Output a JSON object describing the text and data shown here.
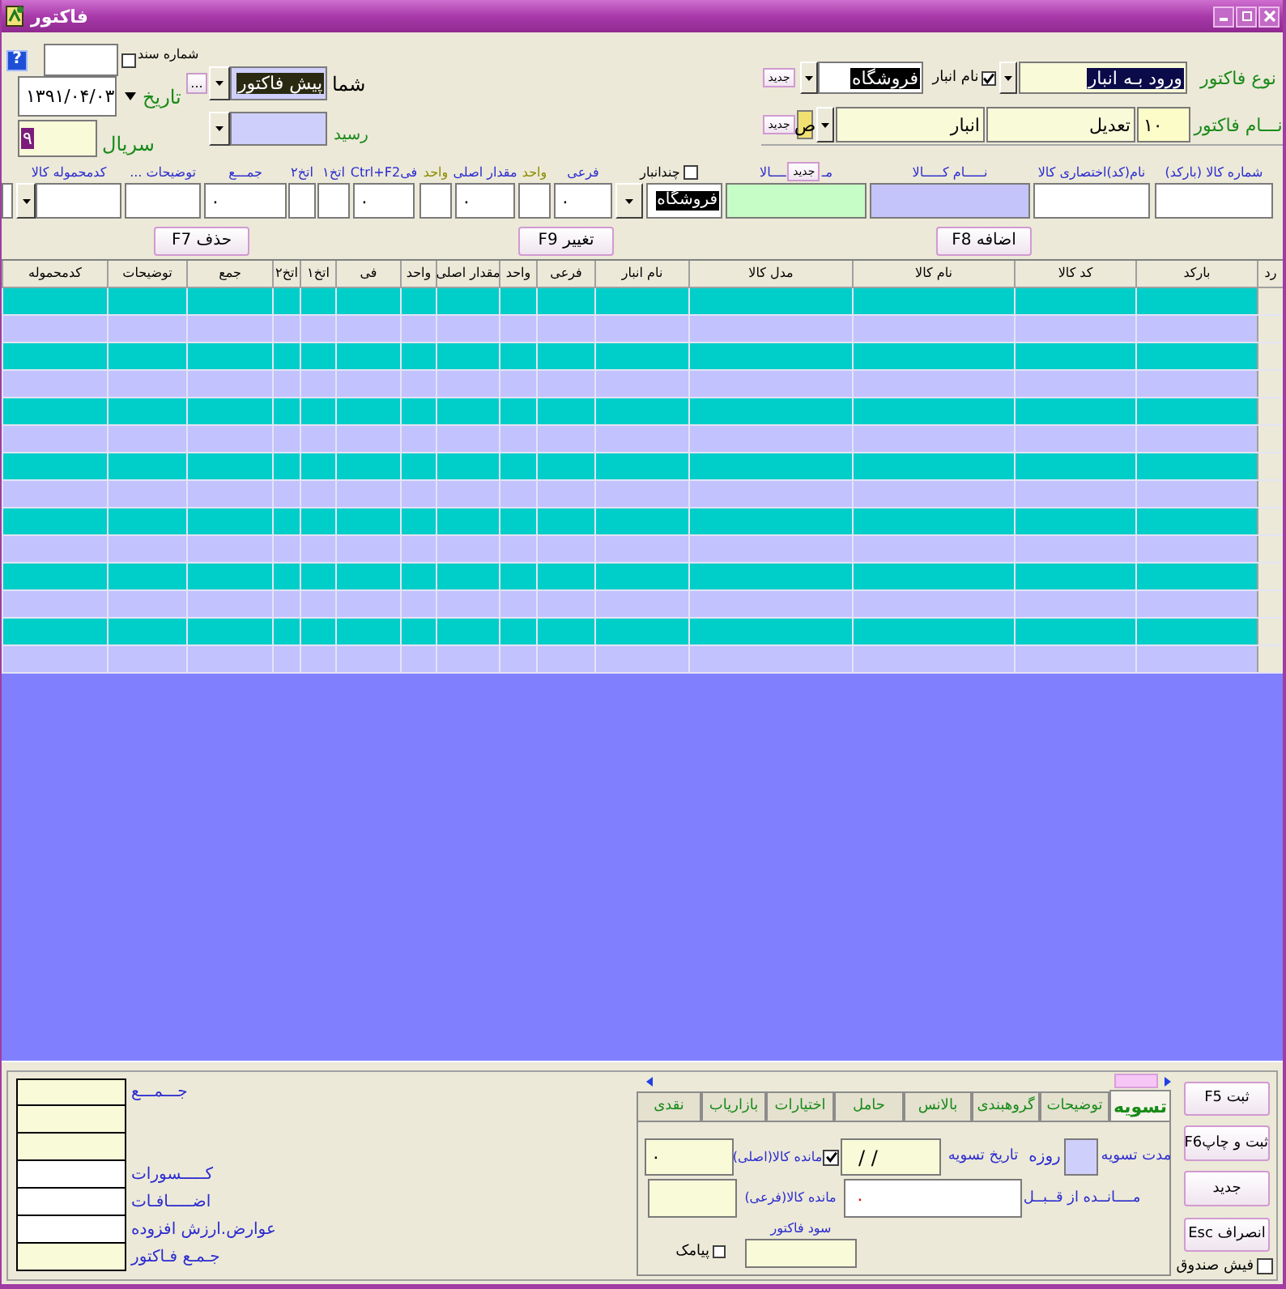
{
  "window": {
    "title": "فاکتور"
  },
  "header": {
    "document_number": {
      "label": "شماره سند",
      "checked": false
    },
    "help_button": "?",
    "date": {
      "label": "تاریخ",
      "value": "۱۳۹۱/۰۴/۰۳"
    },
    "serial": {
      "label": "سریال",
      "value": "۹",
      "highlighted": true
    },
    "party": {
      "label": "شما",
      "value": "پیش فاکتور",
      "highlighted": true,
      "more_button": "..."
    },
    "receipt": {
      "label": "رسید"
    },
    "invoice_type": {
      "label": "نوع فاکتور",
      "value": "ورود بـه انبار",
      "highlighted": true
    },
    "warehouse": {
      "label": "نام انبار",
      "checked": true,
      "value": "فروشگاه",
      "highlighted": true,
      "new_button": "جدید"
    },
    "invoice_name": {
      "label": "نـــام فاکتور",
      "code": "۱۰",
      "name": "تعدیل",
      "group": "انبار",
      "partial_field": "ص",
      "new_button": "جدید"
    }
  },
  "entry": {
    "columns": [
      {
        "label": "شماره کالا (بارکد)",
        "color": "#2b2bd0",
        "kind": "text"
      },
      {
        "label": "نام(کد)اختصاری کالا",
        "color": "#2b2bd0",
        "kind": "text"
      },
      {
        "label": "نـــــام کـــــالا",
        "color": "#2b2bd0",
        "kind": "text"
      },
      {
        "label_parts": [
          "مـ",
          "ــــالا"
        ],
        "new_button": "جدید",
        "color": "#2b2bd0",
        "kind": "text"
      },
      {
        "label": "چندانبار",
        "checked": false,
        "color": "#000000",
        "kind": "combo",
        "value": "فروشگاه",
        "highlighted": true
      },
      {
        "label": "فرعی",
        "color": "#2b2bd0",
        "kind": "text",
        "value": "۰"
      },
      {
        "label": "واحد",
        "color": "#8c8c00",
        "kind": "text"
      },
      {
        "label": "مقدار اصلی",
        "color": "#2b2bd0",
        "kind": "text",
        "value": "۰"
      },
      {
        "label": "واحد",
        "color": "#8c8c00",
        "kind": "text"
      },
      {
        "label": "فیCtrl+F2",
        "color": "#2b2bd0",
        "kind": "text",
        "value": "۰"
      },
      {
        "label": "اتخ۱",
        "color": "#2b2bd0",
        "kind": "text"
      },
      {
        "label": "اتخ۲",
        "color": "#2b2bd0",
        "kind": "text"
      },
      {
        "label": "جمـــع",
        "color": "#2b2bd0",
        "kind": "text",
        "value": "۰"
      },
      {
        "label": "توضیحات ...",
        "color": "#2b2bd0",
        "kind": "text"
      },
      {
        "label": "کدمحموله کالا",
        "color": "#2b2bd0",
        "kind": "combo"
      },
      {
        "kind": "text"
      }
    ]
  },
  "actions": [
    "اضافه F8",
    "تغییر F9",
    "حذف F7"
  ],
  "table": {
    "columns": [
      "رد",
      "بارکد",
      "کد کالا",
      "نام کالا",
      "مدل کالا",
      "نام انبار",
      "فرعی",
      "واحد",
      "مقدار اصلی",
      "واحد",
      "فی",
      "اتخ۱",
      "اتخ۲",
      "جمع",
      "توضیحات",
      "کدمحموله"
    ]
  },
  "side_buttons": [
    "ثبت F5",
    "ثبت و چاپF6",
    "جدید",
    "انصراف Esc"
  ],
  "cash_receipt": {
    "label": "فیش صندوق",
    "checked": false
  },
  "tabs": [
    {
      "label": "تسویه",
      "selected": true
    },
    {
      "label": "توضیحات",
      "selected": false
    },
    {
      "label": "گروهبندی",
      "selected": false
    },
    {
      "label": "بالانس",
      "selected": false
    },
    {
      "label": "حامل",
      "selected": false
    },
    {
      "label": "اختیارات",
      "selected": false
    },
    {
      "label": "بازاریاب",
      "selected": false
    },
    {
      "label": "نقدی",
      "selected": false
    }
  ],
  "settlement": {
    "term": {
      "label": "مدت تسویه",
      "unit": "روزه"
    },
    "due_date": {
      "label": "تاریخ تسویه",
      "value": "/ /"
    },
    "main_remaining": {
      "label": "مانده کالا(اصلی)",
      "checked": true,
      "value": "۰"
    },
    "previous_balance": {
      "label": "مــــانــده از قــبــل",
      "value": "۰"
    },
    "sub_remaining": {
      "label": "مانده کالا(فرعی)"
    },
    "invoice_profit": {
      "label": "سود فاکتور"
    },
    "sms": {
      "label": "پیامک",
      "checked": false
    }
  },
  "totals": [
    {
      "kind": "readonly",
      "label": "جـــمـــع"
    },
    {
      "kind": "readonly"
    },
    {
      "kind": "readonly"
    },
    {
      "kind": "editable",
      "label": "کـــــسورات"
    },
    {
      "kind": "editable",
      "label": "اضـــــافـات"
    },
    {
      "kind": "editable",
      "label": "عوارض.ارزش افزوده"
    },
    {
      "kind": "readonly",
      "label": "جـمـع فـاکتور"
    }
  ]
}
